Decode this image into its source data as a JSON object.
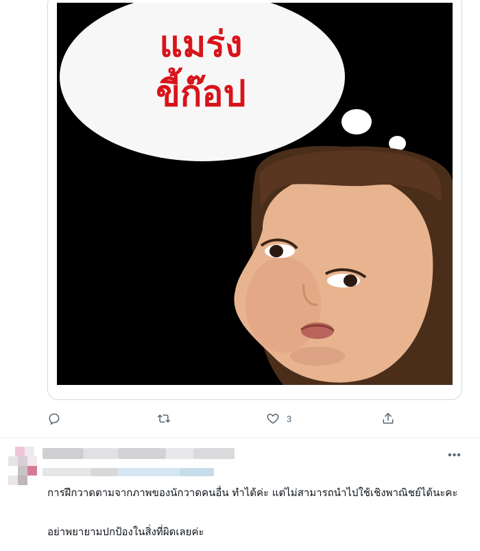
{
  "meme": {
    "caption_line1": "แมร่ง",
    "caption_line2": "ขี้ก๊อป"
  },
  "tweet_actions": {
    "reply_icon": "reply-icon",
    "retweet_icon": "retweet-icon",
    "like_icon": "heart-icon",
    "like_count": "3",
    "share_icon": "share-icon"
  },
  "reply": {
    "more_label": "•••",
    "text_para1": "การฝึกวาดตามจากภาพของนักวาดคนอื่น ทำได้ค่ะ แต่ไม่สามารถนำไปใช้เชิงพาณิชย์ได้นะคะ",
    "text_para2": "อย่าพยายามปกป้องในสิ่งที่ผิดเลยค่ะ"
  },
  "colors": {
    "accent_text": "#d8141b",
    "icon_gray": "#536471",
    "border": "#cfd9de"
  }
}
